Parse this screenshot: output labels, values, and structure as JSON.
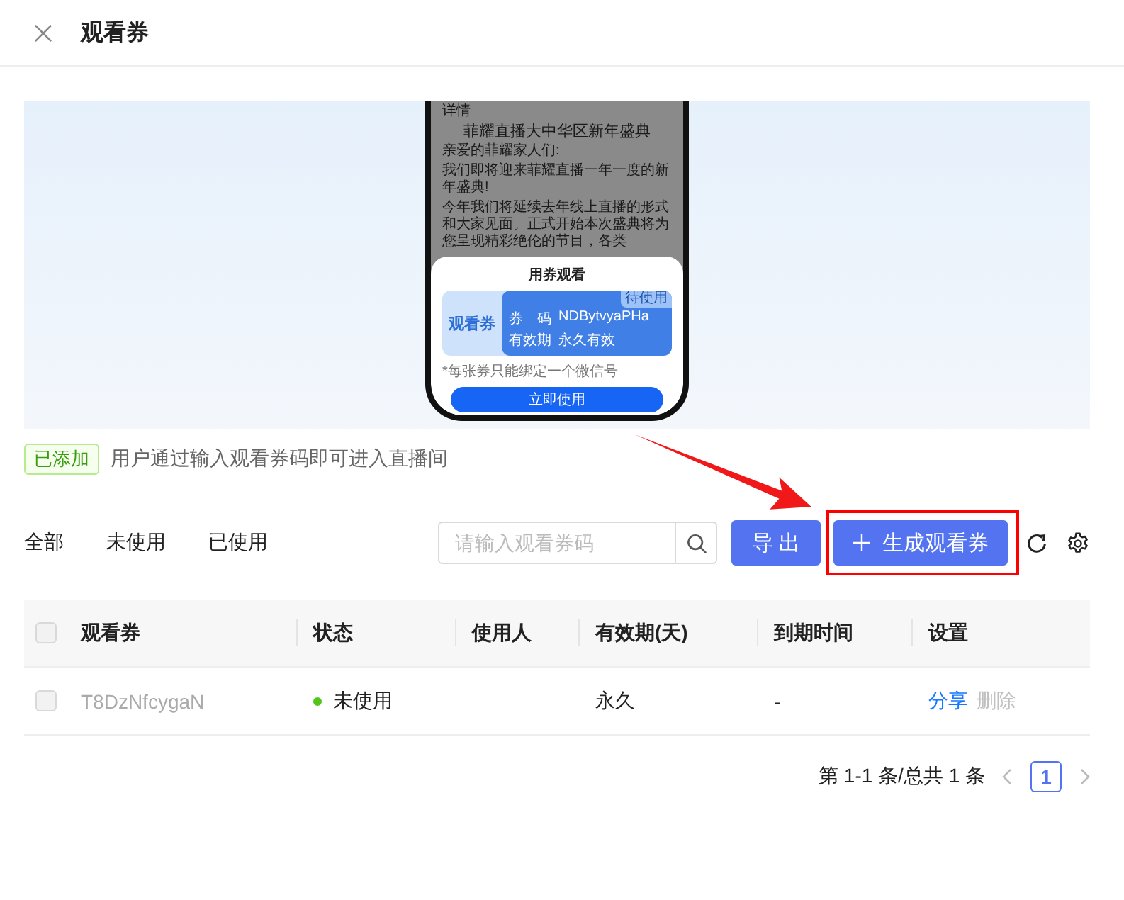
{
  "header": {
    "title": "观看券"
  },
  "banner": {
    "phone": {
      "header": "详情",
      "title": "菲耀直播大中华区新年盛典",
      "paragraphs": [
        "亲爱的菲耀家人们:",
        "我们即将迎来菲耀直播一年一度的新年盛典!",
        "今年我们将延续去年线上直播的形式和大家见面。正式开始本次盛典将为您呈现精彩绝伦的节目，各类"
      ],
      "sheet": {
        "title": "用券观看",
        "ticket": {
          "name": "观看券",
          "code_label": "券　码",
          "code": "NDBytvyaPHa",
          "validity_label": "有效期",
          "validity": "永久有效",
          "badge": "待使用"
        },
        "note": "*每张券只能绑定一个微信号",
        "button": "立即使用"
      }
    }
  },
  "notice": {
    "tag": "已添加",
    "text": "用户通过输入观看券码即可进入直播间"
  },
  "filters": [
    {
      "label": "全部"
    },
    {
      "label": "未使用"
    },
    {
      "label": "已使用"
    }
  ],
  "search": {
    "placeholder": "请输入观看券码"
  },
  "buttons": {
    "export": "导 出",
    "generate": "生成观看券"
  },
  "table": {
    "all_checked": false,
    "columns": [
      "观看券",
      "状态",
      "使用人",
      "有效期(天)",
      "到期时间",
      "设置"
    ],
    "rows": [
      {
        "checked": false,
        "code": "T8DzNfcygaN",
        "status": {
          "text": "未使用",
          "color": "#52c41a"
        },
        "user": "",
        "validity": "永久",
        "expiry": "-",
        "actions": [
          {
            "label": "分享",
            "disabled": false
          },
          {
            "label": "删除",
            "disabled": true
          }
        ]
      }
    ]
  },
  "pagination": {
    "summary": "第 1-1 条/总共 1 条",
    "pages": [
      {
        "label": "1",
        "selected": true
      }
    ]
  }
}
